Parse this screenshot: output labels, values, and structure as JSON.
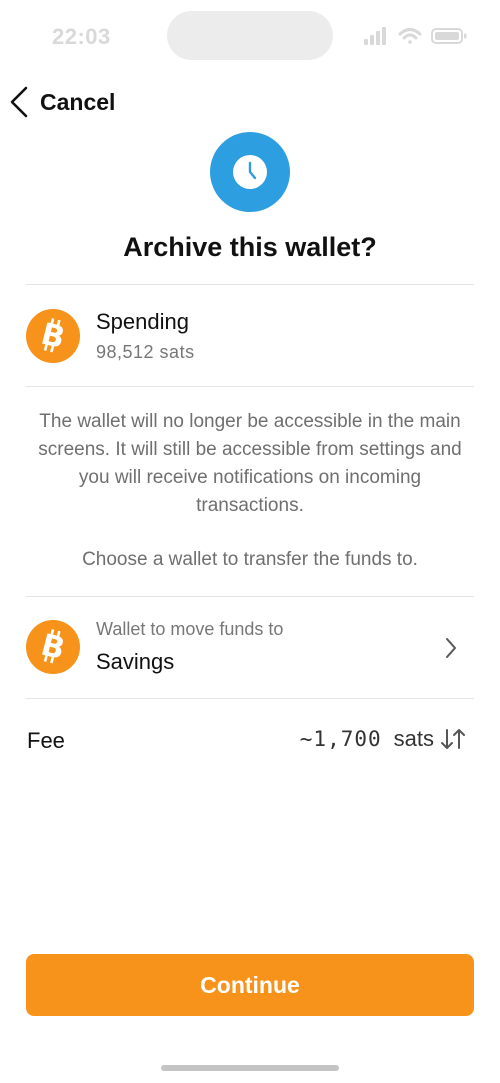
{
  "status_bar": {
    "time": "22:03",
    "icons": [
      "signal-icon",
      "wifi-icon",
      "battery-icon"
    ]
  },
  "nav": {
    "back_label": "Cancel",
    "back_icon": "chevron-left-icon"
  },
  "header": {
    "icon": "clock-icon",
    "title": "Archive this wallet?"
  },
  "source_wallet": {
    "icon": "bitcoin-icon",
    "name": "Spending",
    "balance": "98,512 sats"
  },
  "description": "The wallet will no longer be accessible in the main screens. It will still be accessible from settings and you will receive notifications on incoming transactions.",
  "instruction": "Choose a wallet to transfer the funds to.",
  "destination": {
    "icon": "bitcoin-icon",
    "label": "Wallet to move funds to",
    "value": "Savings",
    "chevron": "chevron-right-icon"
  },
  "fee": {
    "label": "Fee",
    "amount": "~1,700",
    "unit": "sats",
    "swap_icon": "swap-vertical-icon"
  },
  "continue_label": "Continue",
  "colors": {
    "accent": "#f7931a",
    "header_icon": "#2d9ee0",
    "muted_text": "#6f6f6f",
    "divider": "#e3e3e3"
  }
}
